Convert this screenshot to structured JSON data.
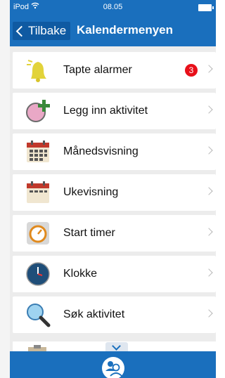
{
  "status_bar": {
    "carrier": "iPod",
    "time": "08.05"
  },
  "nav": {
    "back_label": "Tilbake",
    "title": "Kalendermenyen"
  },
  "menu": [
    {
      "label": "Tapte alarmer",
      "icon": "bell-icon",
      "badge": "3"
    },
    {
      "label": "Legg inn aktivitet",
      "icon": "add-activity-icon"
    },
    {
      "label": "Månedsvisning",
      "icon": "calendar-month-icon"
    },
    {
      "label": "Ukevisning",
      "icon": "calendar-week-icon"
    },
    {
      "label": "Start timer",
      "icon": "timer-icon"
    },
    {
      "label": "Klokke",
      "icon": "clock-icon"
    },
    {
      "label": "Søk aktivitet",
      "icon": "search-icon"
    }
  ],
  "colors": {
    "brand_blue": "#1a6fbd",
    "badge_red": "#e8101a"
  }
}
